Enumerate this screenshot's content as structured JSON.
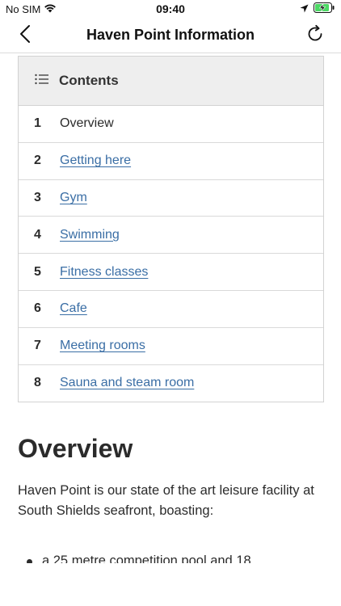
{
  "status_bar": {
    "carrier": "No SIM",
    "time": "09:40"
  },
  "nav": {
    "title": "Haven Point Information",
    "back_icon": "chevron-left-icon",
    "refresh_icon": "refresh-icon"
  },
  "toc": {
    "title": "Contents",
    "items": [
      {
        "num": "1",
        "label": "Overview"
      },
      {
        "num": "2",
        "label": "Getting here"
      },
      {
        "num": "3",
        "label": "Gym"
      },
      {
        "num": "4",
        "label": "Swimming"
      },
      {
        "num": "5",
        "label": "Fitness classes"
      },
      {
        "num": "6",
        "label": "Cafe"
      },
      {
        "num": "7",
        "label": "Meeting rooms"
      },
      {
        "num": "8",
        "label": "Sauna and steam room"
      }
    ]
  },
  "overview": {
    "heading": "Overview",
    "paragraph": "Haven Point is our state of the art leisure facility at South Shields seafront, boasting:",
    "bullets": [
      "a 25 metre competition pool and 18"
    ]
  },
  "colors": {
    "link": "#3a6ea5",
    "text": "#2b2b2b",
    "header_bg": "#eeeeee"
  }
}
